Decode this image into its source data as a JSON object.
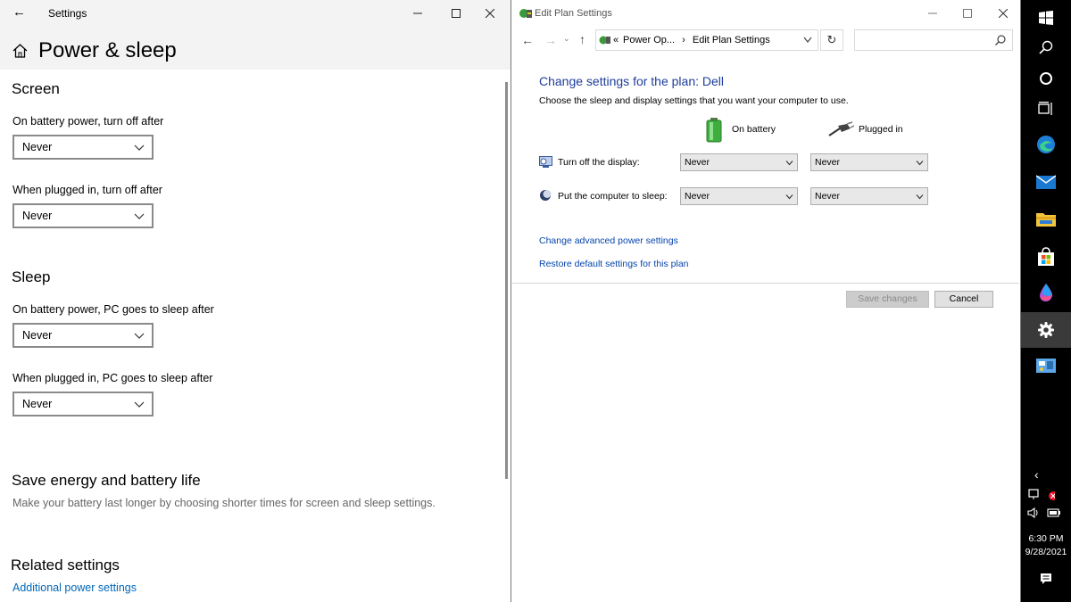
{
  "settings": {
    "window_title": "Settings",
    "page_title": "Power & sleep",
    "screen": {
      "heading": "Screen",
      "battery_label": "On battery power, turn off after",
      "battery_value": "Never",
      "plugged_label": "When plugged in, turn off after",
      "plugged_value": "Never"
    },
    "sleep": {
      "heading": "Sleep",
      "battery_label": "On battery power, PC goes to sleep after",
      "battery_value": "Never",
      "plugged_label": "When plugged in, PC goes to sleep after",
      "plugged_value": "Never"
    },
    "save_energy": {
      "heading": "Save energy and battery life",
      "description": "Make your battery last longer by choosing shorter times for screen and sleep settings."
    },
    "related": {
      "heading": "Related settings",
      "link": "Additional power settings"
    }
  },
  "control_panel": {
    "window_title": "Edit Plan Settings",
    "breadcrumb_prefix": "«",
    "breadcrumb_parent": "Power Op...",
    "breadcrumb_sep": "›",
    "breadcrumb_current": "Edit Plan Settings",
    "search_placeholder": "",
    "title": "Change settings for the plan: Dell",
    "description": "Choose the sleep and display settings that you want your computer to use.",
    "col_battery": "On battery",
    "col_plugged": "Plugged in",
    "display_label": "Turn off the display:",
    "display_battery": "Never",
    "display_plugged": "Never",
    "sleep_label": "Put the computer to sleep:",
    "sleep_battery": "Never",
    "sleep_plugged": "Never",
    "link_advanced": "Change advanced power settings",
    "link_restore": "Restore default settings for this plan",
    "save_button": "Save changes",
    "cancel_button": "Cancel"
  },
  "taskbar": {
    "time": "6:30 PM",
    "date": "9/28/2021"
  },
  "colors": {
    "link_blue": "#0067b8",
    "cp_title_blue": "#1e3d9b",
    "taskbar_bg": "#000000"
  }
}
